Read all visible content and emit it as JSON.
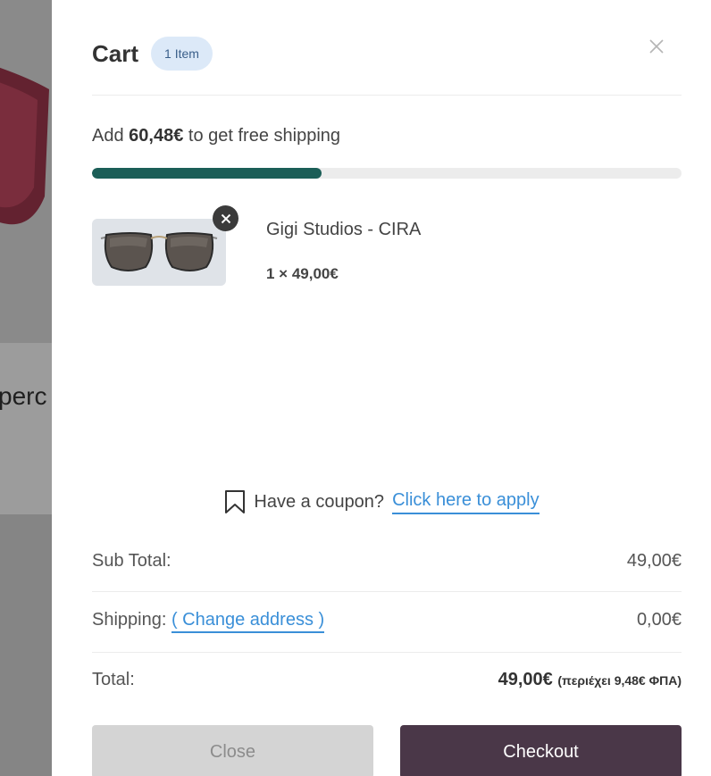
{
  "background": {
    "partial_text": "perc"
  },
  "cart": {
    "title": "Cart",
    "count_badge": "1 Item",
    "shipping_message": {
      "prefix": "Add ",
      "amount": "60,48€",
      "suffix": " to get free shipping",
      "progress_fraction": 0.39
    },
    "items": [
      {
        "name": "Gigi Studios - CIRA",
        "quantity_price": "1 × 49,00€"
      }
    ],
    "coupon": {
      "prompt": "Have a coupon?",
      "link": "Click here to apply"
    },
    "summary": {
      "subtotal_label": "Sub Total:",
      "subtotal_value": "49,00€",
      "shipping_label": "Shipping:",
      "shipping_link": "( Change address )",
      "shipping_value": "0,00€",
      "total_label": "Total:",
      "total_value": "49,00€",
      "total_tax_note": "(περιέχει 9,48€ ΦΠΑ)"
    },
    "buttons": {
      "close": "Close",
      "checkout": "Checkout"
    }
  },
  "colors": {
    "accent_link": "#3a8fd8",
    "progress": "#1b5e57",
    "checkout_button": "#4a3748",
    "badge_bg": "#dce9f8"
  }
}
